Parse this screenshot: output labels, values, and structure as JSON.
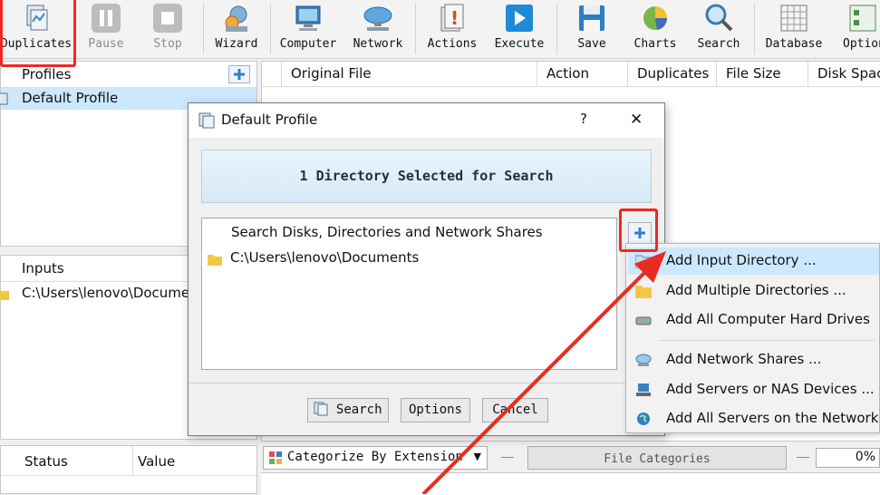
{
  "toolbar": {
    "items": [
      {
        "label": "Duplicates",
        "icon": "duplicates-icon",
        "enabled": true
      },
      {
        "label": "Pause",
        "icon": "pause-icon",
        "enabled": false
      },
      {
        "label": "Stop",
        "icon": "stop-icon",
        "enabled": false
      },
      {
        "label": "Wizard",
        "icon": "wizard-icon",
        "enabled": true
      },
      {
        "label": "Computer",
        "icon": "computer-icon",
        "enabled": true
      },
      {
        "label": "Network",
        "icon": "network-icon",
        "enabled": true
      },
      {
        "label": "Actions",
        "icon": "actions-icon",
        "enabled": true
      },
      {
        "label": "Execute",
        "icon": "execute-icon",
        "enabled": true
      },
      {
        "label": "Save",
        "icon": "save-icon",
        "enabled": true
      },
      {
        "label": "Charts",
        "icon": "charts-icon",
        "enabled": true
      },
      {
        "label": "Search",
        "icon": "search-icon",
        "enabled": true
      },
      {
        "label": "Database",
        "icon": "database-icon",
        "enabled": true
      },
      {
        "label": "Option",
        "icon": "options-icon",
        "enabled": true
      }
    ]
  },
  "profiles_panel": {
    "header": "Profiles",
    "items": [
      "Default Profile"
    ]
  },
  "inputs_panel": {
    "header": "Inputs",
    "items": [
      "C:\\Users\\lenovo\\Documen"
    ]
  },
  "status_panel": {
    "columns": [
      "Status",
      "Value"
    ]
  },
  "results": {
    "columns": [
      "Original File",
      "Action",
      "Duplicates",
      "File Size",
      "Disk Spac"
    ]
  },
  "bottom_bar": {
    "categorize": "Categorize By Extension",
    "file_categories": "File Categories",
    "progress": "0%"
  },
  "dialog": {
    "title": "Default Profile",
    "help": "?",
    "close": "✕",
    "banner": "1 Directory Selected for Search",
    "list_header": "Search Disks, Directories and Network Shares",
    "directories": [
      "C:\\Users\\lenovo\\Documents"
    ],
    "buttons": {
      "search": "Search",
      "options": "Options",
      "cancel": "Cancel"
    }
  },
  "menu": {
    "items": [
      {
        "label": "Add Input Directory ...",
        "icon": "folder-icon",
        "highlighted": true
      },
      {
        "label": "Add Multiple Directories ...",
        "icon": "folders-icon"
      },
      {
        "label": "Add All Computer Hard Drives",
        "icon": "hard-drive-icon"
      },
      {
        "label": "Add Network Shares ...",
        "icon": "network-share-icon"
      },
      {
        "label": "Add Servers or NAS Devices ...",
        "icon": "server-icon"
      },
      {
        "label": "Add All Servers on the Network",
        "icon": "globe-icon"
      }
    ]
  },
  "colors": {
    "accent_highlight": "#cce8ff",
    "annotation_red": "#ec2a24"
  }
}
